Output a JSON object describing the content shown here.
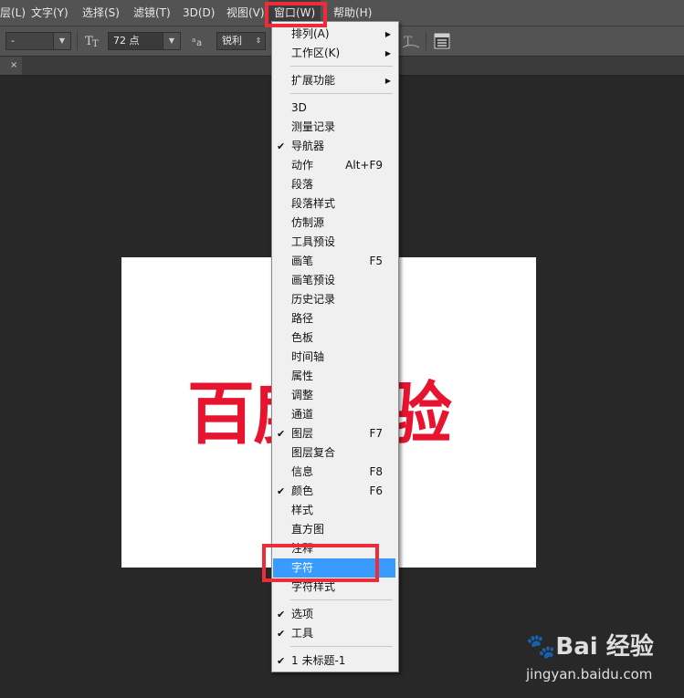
{
  "menubar": {
    "items": [
      "层(L)",
      "文字(Y)",
      "选择(S)",
      "滤镜(T)",
      "3D(D)",
      "视图(V)",
      "窗口(W)",
      "帮助(H)"
    ]
  },
  "options": {
    "font_style": "-",
    "size_icon": "text-size-icon",
    "font_size": "72 点",
    "aa_icon": "antialias-icon",
    "antialias": "锐利"
  },
  "tab": {
    "close": "×"
  },
  "canvas": {
    "text": "百度经验",
    "color": "#e8132f"
  },
  "window_menu": {
    "items": [
      {
        "label": "排列(A)",
        "shortcut": "",
        "checked": false,
        "submenu": true
      },
      {
        "label": "工作区(K)",
        "shortcut": "",
        "checked": false,
        "submenu": true
      },
      {
        "label": "扩展功能",
        "shortcut": "",
        "checked": false,
        "submenu": true
      },
      {
        "label": "3D",
        "shortcut": "",
        "checked": false,
        "submenu": false
      },
      {
        "label": "测量记录",
        "shortcut": "",
        "checked": false,
        "submenu": false
      },
      {
        "label": "导航器",
        "shortcut": "",
        "checked": true,
        "submenu": false
      },
      {
        "label": "动作",
        "shortcut": "Alt+F9",
        "checked": false,
        "submenu": false
      },
      {
        "label": "段落",
        "shortcut": "",
        "checked": false,
        "submenu": false
      },
      {
        "label": "段落样式",
        "shortcut": "",
        "checked": false,
        "submenu": false
      },
      {
        "label": "仿制源",
        "shortcut": "",
        "checked": false,
        "submenu": false
      },
      {
        "label": "工具预设",
        "shortcut": "",
        "checked": false,
        "submenu": false
      },
      {
        "label": "画笔",
        "shortcut": "F5",
        "checked": false,
        "submenu": false
      },
      {
        "label": "画笔预设",
        "shortcut": "",
        "checked": false,
        "submenu": false
      },
      {
        "label": "历史记录",
        "shortcut": "",
        "checked": false,
        "submenu": false
      },
      {
        "label": "路径",
        "shortcut": "",
        "checked": false,
        "submenu": false
      },
      {
        "label": "色板",
        "shortcut": "",
        "checked": false,
        "submenu": false
      },
      {
        "label": "时间轴",
        "shortcut": "",
        "checked": false,
        "submenu": false
      },
      {
        "label": "属性",
        "shortcut": "",
        "checked": false,
        "submenu": false
      },
      {
        "label": "调整",
        "shortcut": "",
        "checked": false,
        "submenu": false
      },
      {
        "label": "通道",
        "shortcut": "",
        "checked": false,
        "submenu": false
      },
      {
        "label": "图层",
        "shortcut": "F7",
        "checked": true,
        "submenu": false
      },
      {
        "label": "图层复合",
        "shortcut": "",
        "checked": false,
        "submenu": false
      },
      {
        "label": "信息",
        "shortcut": "F8",
        "checked": false,
        "submenu": false
      },
      {
        "label": "颜色",
        "shortcut": "F6",
        "checked": true,
        "submenu": false
      },
      {
        "label": "样式",
        "shortcut": "",
        "checked": false,
        "submenu": false
      },
      {
        "label": "直方图",
        "shortcut": "",
        "checked": false,
        "submenu": false
      },
      {
        "label": "注释",
        "shortcut": "",
        "checked": false,
        "submenu": false
      },
      {
        "label": "字符",
        "shortcut": "",
        "checked": false,
        "submenu": false,
        "highlighted": true
      },
      {
        "label": "字符样式",
        "shortcut": "",
        "checked": false,
        "submenu": false
      },
      {
        "label": "选项",
        "shortcut": "",
        "checked": true,
        "submenu": false
      },
      {
        "label": "工具",
        "shortcut": "",
        "checked": true,
        "submenu": false
      },
      {
        "label": "1 未标题-1",
        "shortcut": "",
        "checked": true,
        "submenu": false
      }
    ]
  },
  "check_mark": "✔",
  "submenu_arrow": "▶",
  "highlight_color": "#ee2b39",
  "selection_color": "#3a9bff",
  "watermark": {
    "logo": "Bai 经验",
    "url": "jingyan.baidu.com"
  }
}
